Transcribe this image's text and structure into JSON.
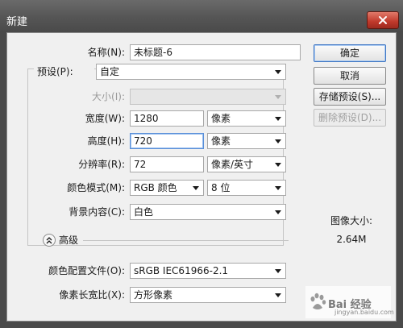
{
  "window": {
    "title": "新建",
    "close_icon": "close-icon"
  },
  "form": {
    "name": {
      "label": "名称(N):",
      "value": "未标题-6"
    },
    "preset": {
      "label": "预设(P):",
      "value": "自定"
    },
    "size": {
      "label": "大小(I):",
      "value": ""
    },
    "width": {
      "label": "宽度(W):",
      "value": "1280",
      "unit": "像素"
    },
    "height": {
      "label": "高度(H):",
      "value": "720",
      "unit": "像素"
    },
    "resolution": {
      "label": "分辨率(R):",
      "value": "72",
      "unit": "像素/英寸"
    },
    "color_mode": {
      "label": "颜色模式(M):",
      "value": "RGB 颜色",
      "depth": "8 位"
    },
    "background": {
      "label": "背景内容(C):",
      "value": "白色"
    },
    "advanced": {
      "label": "高级"
    },
    "color_profile": {
      "label": "颜色配置文件(O):",
      "value": "sRGB IEC61966-2.1"
    },
    "pixel_aspect": {
      "label": "像素长宽比(X):",
      "value": "方形像素"
    }
  },
  "buttons": {
    "ok": "确定",
    "cancel": "取消",
    "save_preset": "存储预设(S)...",
    "delete_preset": "删除预设(D)..."
  },
  "image_size": {
    "label": "图像大小:",
    "value": "2.64M"
  },
  "watermark": {
    "text": "Bai 经验",
    "sub": "jingyan.baidu.com"
  }
}
